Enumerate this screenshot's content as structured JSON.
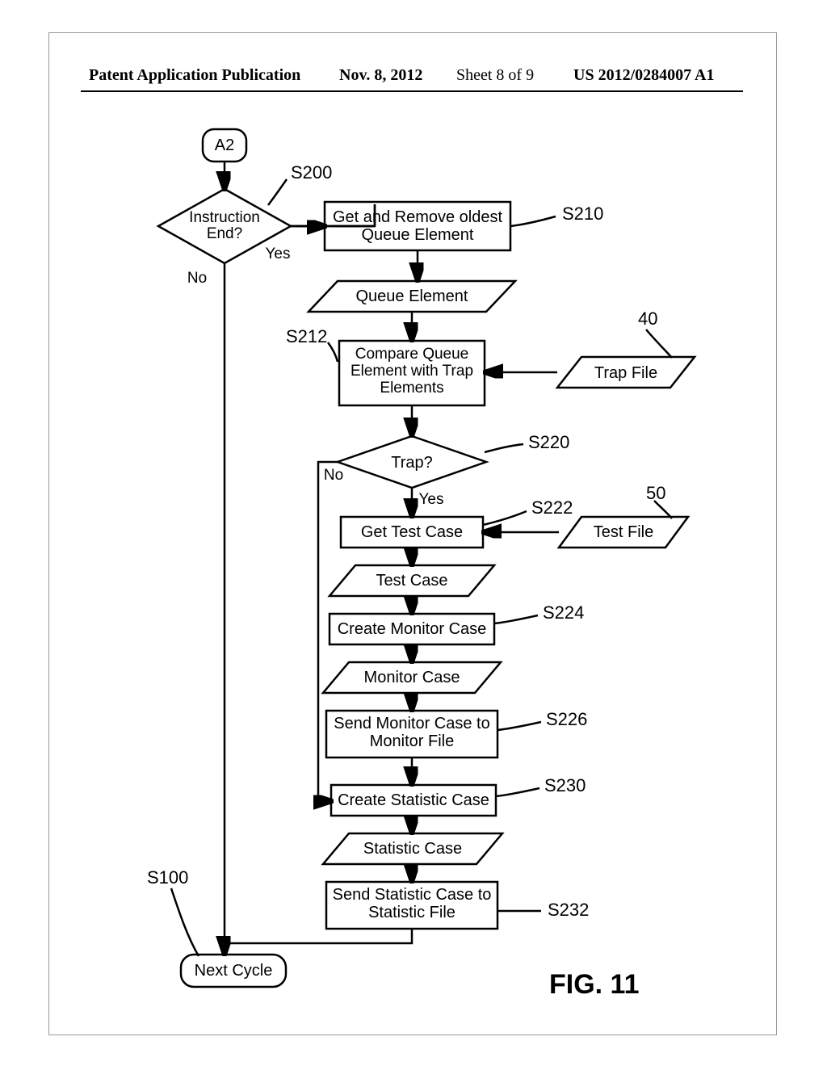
{
  "header": {
    "pub_type": "Patent Application Publication",
    "pub_date": "Nov. 8, 2012",
    "sheet": "Sheet 8 of 9",
    "pub_num": "US 2012/0284007 A1"
  },
  "fig_label": "FIG. 11",
  "connector_a2": "A2",
  "decision_s200": {
    "text": "Instruction\nEnd?",
    "yes": "Yes",
    "no": "No",
    "label": "S200"
  },
  "s210": {
    "text": "Get and Remove oldest\nQueue Element",
    "label": "S210"
  },
  "data_queue_element": "Queue Element",
  "s212": {
    "text": "Compare Queue\nElement with Trap\nElements",
    "label": "S212"
  },
  "data_trap_file": {
    "text": "Trap File",
    "label": "40"
  },
  "decision_s220": {
    "text": "Trap?",
    "yes": "Yes",
    "no": "No",
    "label": "S220"
  },
  "s222": {
    "text": "Get Test Case",
    "label": "S222"
  },
  "data_test_file": {
    "text": "Test File",
    "label": "50"
  },
  "data_test_case": "Test Case",
  "s224": {
    "text": "Create Monitor Case",
    "label": "S224"
  },
  "data_monitor_case": "Monitor Case",
  "s226": {
    "text": "Send Monitor Case to\nMonitor File",
    "label": "S226"
  },
  "s230": {
    "text": "Create Statistic Case",
    "label": "S230"
  },
  "data_statistic_case": "Statistic Case",
  "s232": {
    "text": "Send Statistic Case to\nStatistic File",
    "label": "S232"
  },
  "s100": {
    "text": "Next Cycle",
    "label": "S100"
  }
}
